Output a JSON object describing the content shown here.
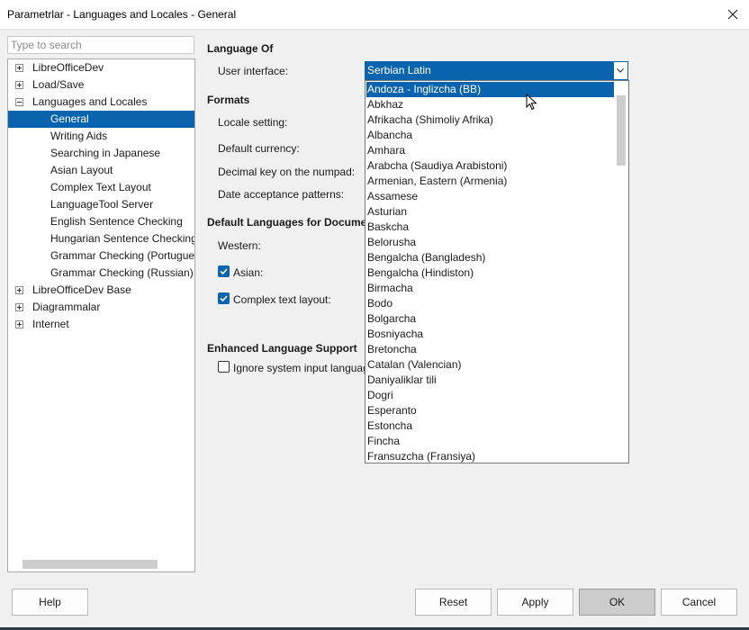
{
  "window": {
    "title": "Parametrlar - Languages and Locales - General"
  },
  "search": {
    "placeholder": "Type to search"
  },
  "tree": [
    {
      "label": "LibreOfficeDev",
      "level": 0,
      "expander": "plus"
    },
    {
      "label": "Load/Save",
      "level": 0,
      "expander": "plus"
    },
    {
      "label": "Languages and Locales",
      "level": 0,
      "expander": "minus"
    },
    {
      "label": "General",
      "level": 1,
      "selected": true
    },
    {
      "label": "Writing Aids",
      "level": 1
    },
    {
      "label": "Searching in Japanese",
      "level": 1
    },
    {
      "label": "Asian Layout",
      "level": 1
    },
    {
      "label": "Complex Text Layout",
      "level": 1
    },
    {
      "label": "LanguageTool Server",
      "level": 1
    },
    {
      "label": "English Sentence Checking",
      "level": 1
    },
    {
      "label": "Hungarian Sentence Checking",
      "level": 1
    },
    {
      "label": "Grammar Checking (Portugues",
      "level": 1
    },
    {
      "label": "Grammar Checking (Russian)",
      "level": 1
    },
    {
      "label": "LibreOfficeDev Base",
      "level": 0,
      "expander": "plus"
    },
    {
      "label": "Diagrammalar",
      "level": 0,
      "expander": "plus"
    },
    {
      "label": "Internet",
      "level": 0,
      "expander": "plus"
    }
  ],
  "panel": {
    "language_of_heading": "Language Of",
    "user_interface_label": "User interface:",
    "formats_heading": "Formats",
    "locale_setting_label": "Locale setting:",
    "default_currency_label": "Default currency:",
    "decimal_key_label": "Decimal key on the numpad:",
    "date_patterns_label": "Date acceptance patterns:",
    "default_languages_heading": "Default Languages for Documen",
    "western_label": "Western:",
    "asian_label": "Asian:",
    "asian_checked": true,
    "ctl_label": "Complex text layout:",
    "ctl_checked": true,
    "enhanced_heading": "Enhanced Language Support",
    "ignore_input_label": "Ignore system input languag",
    "ignore_input_checked": false
  },
  "ui_combo": {
    "value": "Serbian Latin",
    "options": [
      "Andoza - Inglizcha (BB)",
      "Abkhaz",
      "Afrikacha (Shimoliy Afrika)",
      "Albancha",
      "Amhara",
      "Arabcha (Saudiya Arabistoni)",
      "Armenian, Eastern (Armenia)",
      "Assamese",
      "Asturian",
      "Baskcha",
      "Belorusha",
      "Bengalcha (Bangladesh)",
      "Bengalcha (Hindiston)",
      "Birmacha",
      "Bodo",
      "Bolgarcha",
      "Bosniyacha",
      "Bretoncha",
      "Catalan (Valencian)",
      "Daniyaliklar tili",
      "Dogri",
      "Esperanto",
      "Estoncha",
      "Fincha",
      "Fransuzcha (Fransiya)"
    ],
    "highlighted_index": 0
  },
  "buttons": {
    "help": "Help",
    "reset": "Reset",
    "apply": "Apply",
    "ok": "OK",
    "cancel": "Cancel"
  },
  "colors": {
    "accent": "#0a64ad",
    "selection_text": "#ffffff"
  }
}
